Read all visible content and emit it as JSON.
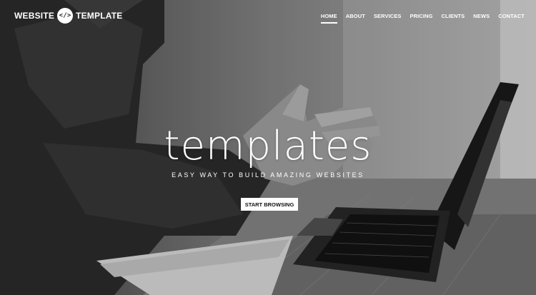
{
  "brand": {
    "name_left": "WEBSITE",
    "badge": "</>",
    "name_right": "TEMPLATE",
    "icon": "code-icon"
  },
  "nav": {
    "items": [
      {
        "label": "HOME",
        "active": true
      },
      {
        "label": "ABOUT",
        "active": false
      },
      {
        "label": "SERVICES",
        "active": false
      },
      {
        "label": "PRICING",
        "active": false
      },
      {
        "label": "CLIENTS",
        "active": false
      },
      {
        "label": "NEWS",
        "active": false
      },
      {
        "label": "CONTACT",
        "active": false
      }
    ]
  },
  "hero": {
    "headline": "templates",
    "tagline": "EASY WAY TO BUILD AMAZING WEBSITES",
    "cta_label": "START BROWSING"
  },
  "colors": {
    "text": "#ffffff",
    "button_bg": "#ffffff",
    "button_text": "#111111"
  }
}
